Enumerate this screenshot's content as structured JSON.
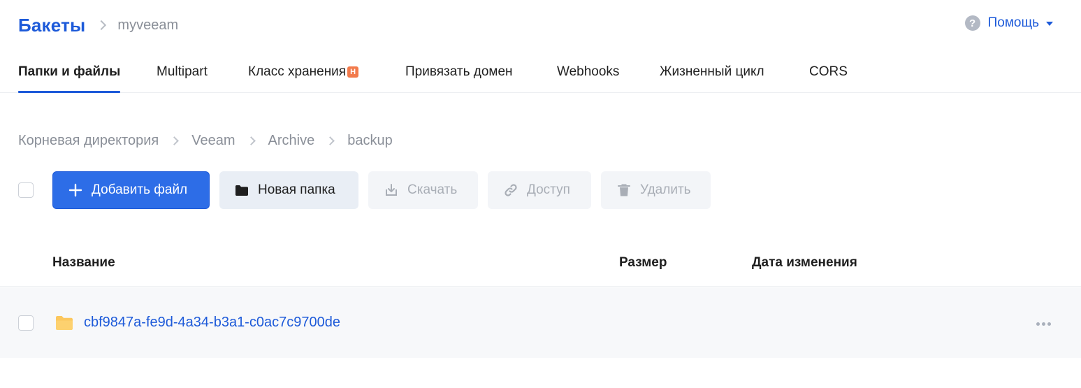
{
  "header": {
    "title": "Бакеты",
    "bucket_name": "myveeam",
    "help_label": "Помощь"
  },
  "tabs": [
    {
      "label": "Папки и файлы",
      "active": true
    },
    {
      "label": "Multipart",
      "active": false
    },
    {
      "label": "Класс хранения",
      "badge": "Н",
      "active": false
    },
    {
      "label": "Привязать домен",
      "active": false
    },
    {
      "label": "Webhooks",
      "active": false
    },
    {
      "label": "Жизненный цикл",
      "active": false
    },
    {
      "label": "CORS",
      "active": false
    }
  ],
  "path": [
    "Корневая директория",
    "Veeam",
    "Archive",
    "backup"
  ],
  "toolbar": {
    "add_file": "Добавить файл",
    "new_folder": "Новая папка",
    "download": "Скачать",
    "access": "Доступ",
    "delete": "Удалить"
  },
  "table": {
    "columns": [
      "Название",
      "Размер",
      "Дата изменения"
    ],
    "rows": [
      {
        "name": "cbf9847a-fe9d-4a34-b3a1-c0ac7c9700de",
        "type": "folder",
        "size": "",
        "modified": ""
      }
    ]
  },
  "colors": {
    "accent": "#1d5ad9",
    "primary_button": "#2d6de7",
    "badge": "#f27a4b",
    "folder": "#fcc75e"
  }
}
